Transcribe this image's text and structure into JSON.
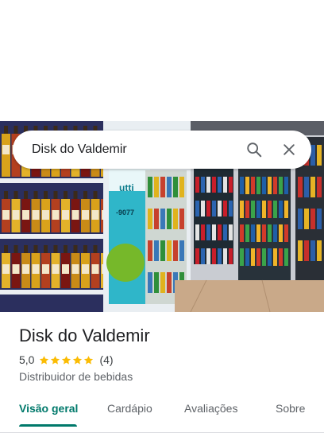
{
  "search": {
    "query": "Disk do Valdemir"
  },
  "place": {
    "name": "Disk do Valdemir",
    "rating_text": "5,0",
    "rating_value": 5,
    "review_count_text": "(4)",
    "category": "Distribuidor de bebidas"
  },
  "photo": {
    "sign_text": "utti",
    "phone_text": "-9077"
  },
  "tabs": [
    {
      "label": "Visão geral",
      "active": true
    },
    {
      "label": "Cardápio",
      "active": false
    },
    {
      "label": "Avaliações",
      "active": false
    },
    {
      "label": "Sobre",
      "active": false
    }
  ],
  "icons": {
    "search": "search-icon",
    "close": "close-icon",
    "star": "star-icon"
  },
  "colors": {
    "accent": "#00796b",
    "star": "#fbbc04",
    "text": "#202124",
    "secondary": "#5f6368"
  }
}
